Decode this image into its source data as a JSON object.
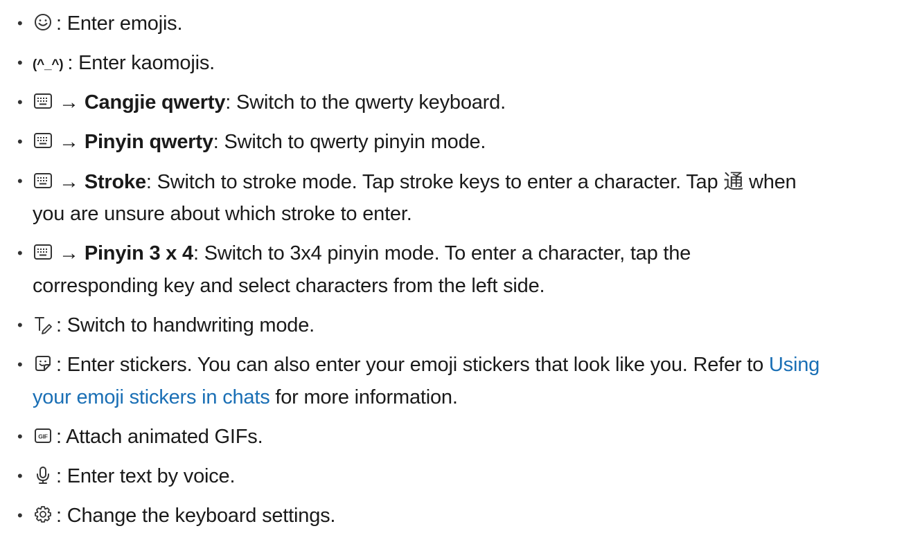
{
  "items": [
    {
      "icon": "emoji-icon",
      "text": ": Enter emojis."
    },
    {
      "icon_text": "(^_^)",
      "text": ": Enter kaomojis."
    },
    {
      "icon": "keyboard-icon",
      "arrow": "→",
      "label": "Cangjie qwerty",
      "text": ": Switch to the qwerty keyboard."
    },
    {
      "icon": "keyboard-icon",
      "arrow": "→",
      "label": "Pinyin qwerty",
      "text": ": Switch to qwerty pinyin mode."
    },
    {
      "icon": "keyboard-icon",
      "arrow": "→",
      "label": "Stroke",
      "text": ": Switch to stroke mode. Tap stroke keys to enter a character. Tap",
      "char": "通",
      "text_after_char": "when",
      "line2": "you are unsure about which stroke to enter."
    },
    {
      "icon": "keyboard-icon",
      "arrow": "→",
      "label": "Pinyin 3 x 4",
      "text": ": Switch to 3x4 pinyin mode. To enter a character, tap the",
      "line2": "corresponding key and select characters from the left side."
    },
    {
      "icon": "handwriting-icon",
      "text": ": Switch to handwriting mode."
    },
    {
      "icon": "sticker-icon",
      "text": ": Enter stickers. You can also enter your emoji stickers that look like you. Refer to",
      "link_part1": "Using",
      "link_part2": "your emoji stickers in chats",
      "line2_after": "for more information."
    },
    {
      "icon": "gif-icon",
      "icon_label": "GIF",
      "text": ": Attach animated GIFs."
    },
    {
      "icon": "microphone-icon",
      "text": ": Enter text by voice."
    },
    {
      "icon": "settings-gear-icon",
      "text": ": Change the keyboard settings."
    }
  ],
  "bullet": "•",
  "colors": {
    "text": "#1a1a1a",
    "link": "#1a6fb5"
  }
}
